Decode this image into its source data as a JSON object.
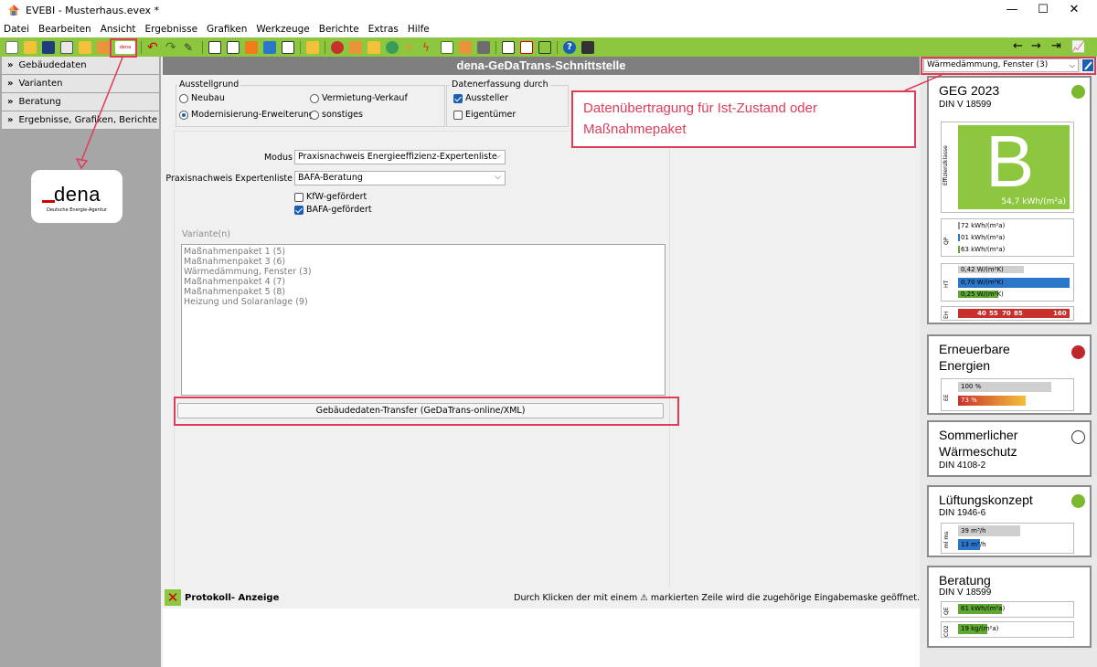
{
  "window": {
    "title": "EVEBI  -  Musterhaus.evex *",
    "minimize": "—",
    "maximize": "☐",
    "close": "✕"
  },
  "menu": [
    "Datei",
    "Bearbeiten",
    "Ansicht",
    "Ergebnisse",
    "Grafiken",
    "Werkzeuge",
    "Berichte",
    "Extras",
    "Hilfe"
  ],
  "toolbar": {
    "dena_label": "dena",
    "back": "←",
    "forward": "→",
    "jump": "⇥",
    "chart": "📈"
  },
  "left_panel": {
    "items": [
      "Gebäudedaten",
      "Varianten",
      "Beratung",
      "Ergebnisse, Grafiken, Berichte"
    ],
    "logo": {
      "word": "dena",
      "subtitle": "Deutsche Energie-Agentur"
    }
  },
  "center": {
    "title": "dena-GeDaTrans-Schnittstelle",
    "ausstellgrund": {
      "title": "Ausstellgrund",
      "options": [
        "Neubau",
        "Vermietung-Verkauf",
        "Modernisierung-Erweiterung",
        "sonstiges"
      ],
      "selected": "Modernisierung-Erweiterung"
    },
    "erfassung": {
      "title": "Datenerfassung durch",
      "aussteller": "Aussteller",
      "eigentuemer": "Eigentümer"
    },
    "modus_label": "Modus",
    "modus_value": "Praxisnachweis Energieeffizienz-Expertenliste",
    "expertenliste_label": "Praxisnachweis Expertenliste",
    "expertenliste_value": "BAFA-Beratung",
    "kfw_label": "KfW-gefördert",
    "bafa_label": "BAFA-gefördert",
    "variante_label": "Variante(n)",
    "variants": [
      "Maßnahmenpaket 1 (5)",
      "Maßnahmenpaket 3 (6)",
      "Wärmedämmung, Fenster (3)",
      "Maßnahmenpaket 4 (7)",
      "Maßnahmenpaket 5 (8)",
      "Heizung und Solaranlage (9)"
    ],
    "transfer_button": "Gebäudedaten-Transfer (GeDaTrans-online/XML)"
  },
  "protokoll": {
    "close": "✕",
    "title": "Protokoll- Anzeige",
    "hint": "Durch Klicken der mit einem ⚠ markierten Zeile wird die zugehörige Eingabemaske geöffnet."
  },
  "callout": "Datenübertragung für Ist-Zustand oder Maßnahmepaket",
  "right_panel": {
    "selected_variant": "Wärmedämmung, Fenster (3)",
    "geg": {
      "title": "GEG 2023",
      "norm": "DIN V 18599",
      "side_label": "Effizienzklasse",
      "class": "B",
      "value": "54,7 kWh/(m²a)",
      "qp_label": "QP",
      "qp": [
        "72 kWh/(m²a)",
        "01 kWh/(m²a)",
        "63 kWh/(m²a)"
      ],
      "ht_label": "HT",
      "ht": [
        "0,42 W/(m²K)",
        "0,70 W/(m²K)",
        "0,25 W/(m²K)"
      ],
      "eh_label": "EH",
      "eh_ticks": [
        "40",
        "55",
        "70",
        "85",
        "160"
      ],
      "status_color": "#7ab82e"
    },
    "ee": {
      "title_1": "Erneuerbare",
      "title_2": "Energien",
      "label": "EE",
      "bars": [
        "100 %",
        "73 %"
      ],
      "status_color": "#c0272d"
    },
    "sommer": {
      "title_1": "Sommerlicher",
      "title_2": "Wärmeschutz",
      "norm": "DIN 4108-2"
    },
    "lueftung": {
      "title": "Lüftungskonzept",
      "norm": "DIN 1946-6",
      "label": "ml ms",
      "bars": [
        "39 m³/h",
        "13 m³/h"
      ],
      "status_color": "#7ab82e"
    },
    "beratung": {
      "title": "Beratung",
      "norm": "DIN V 18599",
      "qe_label": "QE",
      "qe": "61 kWh/(m²a)",
      "co2_label": "CO2",
      "co2": "19 kg/(m²a)"
    }
  }
}
